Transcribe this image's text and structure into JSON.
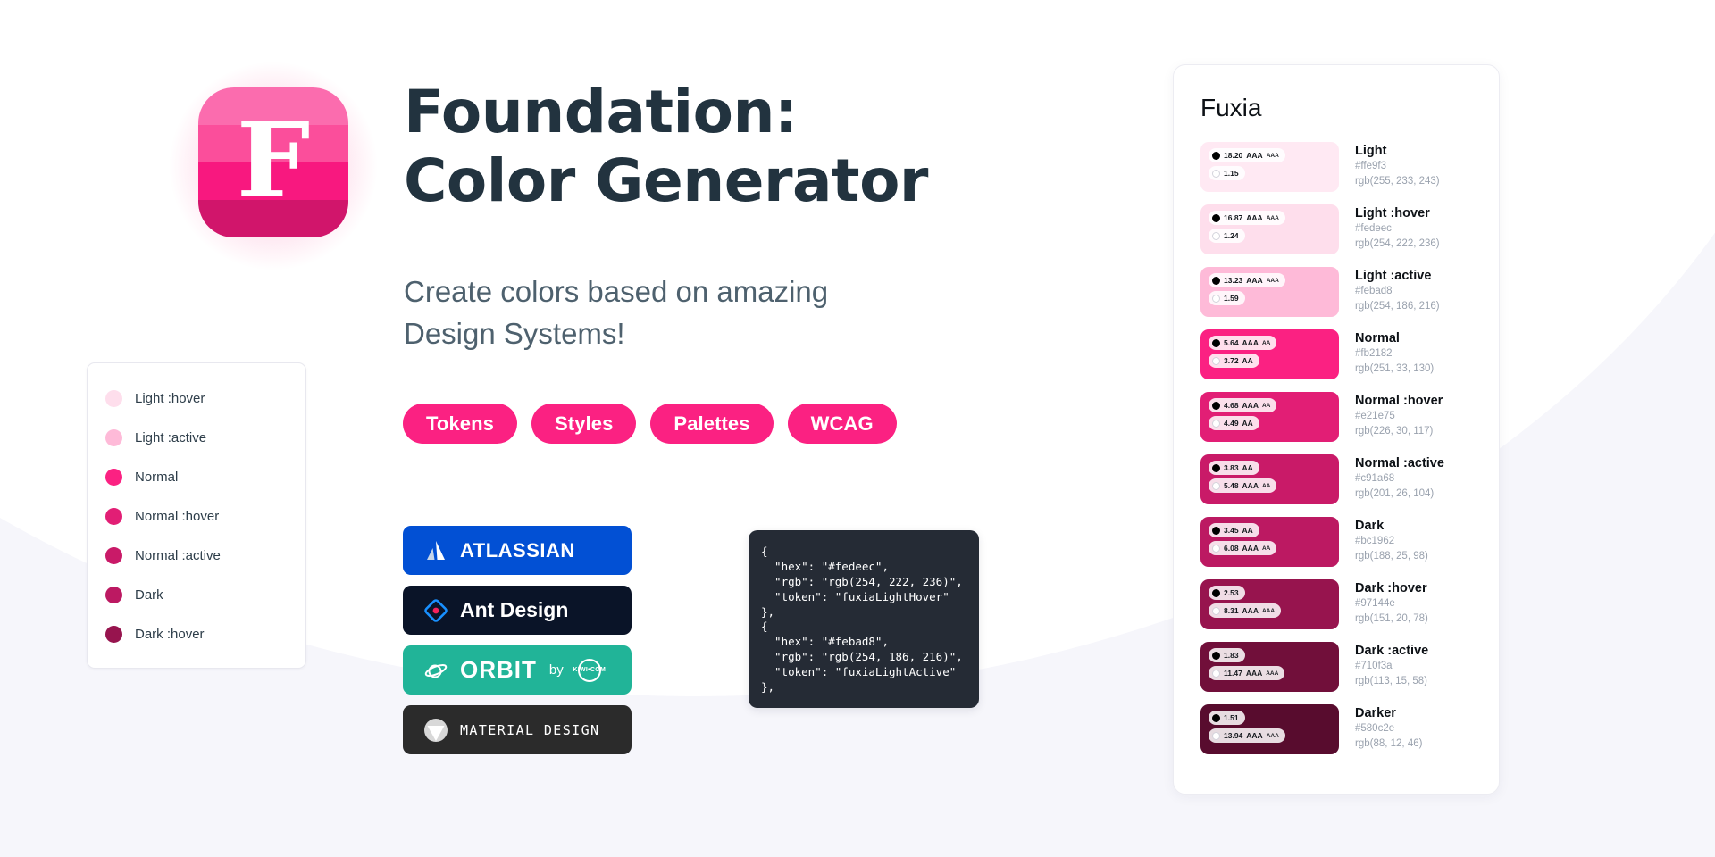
{
  "theme": {
    "page_background": "#f6f6fb",
    "surface": "#ffffff",
    "accent": "#fb2182",
    "heading_color": "#22333f",
    "subhead_color": "#4e616e",
    "muted_text": "#9aa2ae"
  },
  "logo": {
    "letter": "F",
    "bands": [
      "#fb6cae",
      "#fb4e9b",
      "#f8187f",
      "#d1156b"
    ],
    "glow_color": "#fa3c8c"
  },
  "hero": {
    "title": "Foundation:\nColor Generator",
    "subtitle": "Create colors based on amazing\nDesign Systems!"
  },
  "pills": [
    {
      "label": "Tokens"
    },
    {
      "label": "Styles"
    },
    {
      "label": "Palettes"
    },
    {
      "label": "WCAG"
    }
  ],
  "legend": {
    "items": [
      {
        "label": "Light :hover",
        "color": "#fedeec"
      },
      {
        "label": "Light :active",
        "color": "#febad8"
      },
      {
        "label": "Normal",
        "color": "#fb2182"
      },
      {
        "label": "Normal :hover",
        "color": "#e21e75"
      },
      {
        "label": "Normal :active",
        "color": "#c91a68"
      },
      {
        "label": "Dark",
        "color": "#bc1962"
      },
      {
        "label": "Dark :hover",
        "color": "#97144e"
      }
    ]
  },
  "brands": [
    {
      "name": "Atlassian",
      "label": "ATLASSIAN",
      "background": "#0250d4",
      "icon": "atlassian-icon"
    },
    {
      "name": "Ant Design",
      "label": "Ant Design",
      "background": "#0a1428",
      "icon": "ant-design-icon"
    },
    {
      "name": "Orbit by Kiwi",
      "label": "ORBIT",
      "background": "#21b498",
      "icon": "orbit-planet-icon",
      "by": "by",
      "kiwi": "KIWI•COM"
    },
    {
      "name": "Material Design",
      "label": "MATERIAL DESIGN",
      "background": "#2b2b2b",
      "icon": "material-design-icon"
    }
  ],
  "code_block": {
    "content": "{\n  \"hex\": \"#fedeec\",\n  \"rgb\": \"rgb(254, 222, 236)\",\n  \"token\": \"fuxiaLightHover\"\n},\n{\n  \"hex\": \"#febad8\",\n  \"rgb\": \"rgb(254, 186, 216)\",\n  \"token\": \"fuxiaLightActive\"\n},"
  },
  "palette": {
    "title": "Fuxia",
    "swatches": [
      {
        "name": "Light",
        "hex": "#ffe9f3",
        "rgb": "rgb(255, 233, 243)",
        "black_ratio": "18.20",
        "black_level": "AAA",
        "black_level_small": "AAA",
        "white_ratio": "1.15",
        "white_level": "",
        "white_level_small": ""
      },
      {
        "name": "Light :hover",
        "hex": "#fedeec",
        "rgb": "rgb(254, 222, 236)",
        "black_ratio": "16.87",
        "black_level": "AAA",
        "black_level_small": "AAA",
        "white_ratio": "1.24",
        "white_level": "",
        "white_level_small": ""
      },
      {
        "name": "Light :active",
        "hex": "#febad8",
        "rgb": "rgb(254, 186, 216)",
        "black_ratio": "13.23",
        "black_level": "AAA",
        "black_level_small": "AAA",
        "white_ratio": "1.59",
        "white_level": "",
        "white_level_small": ""
      },
      {
        "name": "Normal",
        "hex": "#fb2182",
        "rgb": "rgb(251, 33, 130)",
        "black_ratio": "5.64",
        "black_level": "AAA",
        "black_level_small": "AA",
        "white_ratio": "3.72",
        "white_level": "AA",
        "white_level_small": ""
      },
      {
        "name": "Normal :hover",
        "hex": "#e21e75",
        "rgb": "rgb(226, 30, 117)",
        "black_ratio": "4.68",
        "black_level": "AAA",
        "black_level_small": "AA",
        "white_ratio": "4.49",
        "white_level": "AA",
        "white_level_small": ""
      },
      {
        "name": "Normal :active",
        "hex": "#c91a68",
        "rgb": "rgb(201, 26, 104)",
        "black_ratio": "3.83",
        "black_level": "AA",
        "black_level_small": "",
        "white_ratio": "5.48",
        "white_level": "AAA",
        "white_level_small": "AA"
      },
      {
        "name": "Dark",
        "hex": "#bc1962",
        "rgb": "rgb(188, 25, 98)",
        "black_ratio": "3.45",
        "black_level": "AA",
        "black_level_small": "",
        "white_ratio": "6.08",
        "white_level": "AAA",
        "white_level_small": "AA"
      },
      {
        "name": "Dark :hover",
        "hex": "#97144e",
        "rgb": "rgb(151, 20, 78)",
        "black_ratio": "2.53",
        "black_level": "",
        "black_level_small": "",
        "white_ratio": "8.31",
        "white_level": "AAA",
        "white_level_small": "AAA"
      },
      {
        "name": "Dark :active",
        "hex": "#710f3a",
        "rgb": "rgb(113, 15, 58)",
        "black_ratio": "1.83",
        "black_level": "",
        "black_level_small": "",
        "white_ratio": "11.47",
        "white_level": "AAA",
        "white_level_small": "AAA"
      },
      {
        "name": "Darker",
        "hex": "#580c2e",
        "rgb": "rgb(88, 12, 46)",
        "black_ratio": "1.51",
        "black_level": "",
        "black_level_small": "",
        "white_ratio": "13.94",
        "white_level": "AAA",
        "white_level_small": "AAA"
      }
    ]
  }
}
